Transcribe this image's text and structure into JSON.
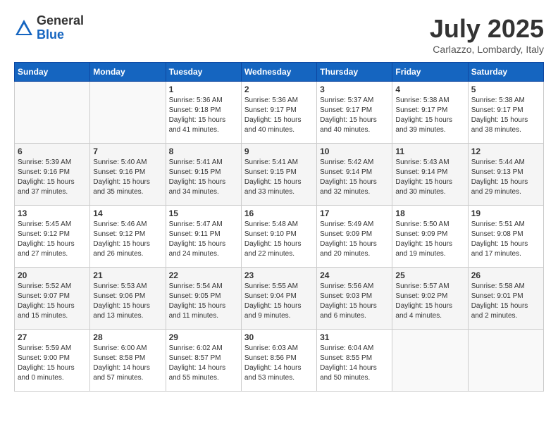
{
  "header": {
    "logo_general": "General",
    "logo_blue": "Blue",
    "month_year": "July 2025",
    "location": "Carlazzo, Lombardy, Italy"
  },
  "days_of_week": [
    "Sunday",
    "Monday",
    "Tuesday",
    "Wednesday",
    "Thursday",
    "Friday",
    "Saturday"
  ],
  "weeks": [
    [
      {
        "num": "",
        "lines": []
      },
      {
        "num": "",
        "lines": []
      },
      {
        "num": "1",
        "lines": [
          "Sunrise: 5:36 AM",
          "Sunset: 9:18 PM",
          "Daylight: 15 hours",
          "and 41 minutes."
        ]
      },
      {
        "num": "2",
        "lines": [
          "Sunrise: 5:36 AM",
          "Sunset: 9:17 PM",
          "Daylight: 15 hours",
          "and 40 minutes."
        ]
      },
      {
        "num": "3",
        "lines": [
          "Sunrise: 5:37 AM",
          "Sunset: 9:17 PM",
          "Daylight: 15 hours",
          "and 40 minutes."
        ]
      },
      {
        "num": "4",
        "lines": [
          "Sunrise: 5:38 AM",
          "Sunset: 9:17 PM",
          "Daylight: 15 hours",
          "and 39 minutes."
        ]
      },
      {
        "num": "5",
        "lines": [
          "Sunrise: 5:38 AM",
          "Sunset: 9:17 PM",
          "Daylight: 15 hours",
          "and 38 minutes."
        ]
      }
    ],
    [
      {
        "num": "6",
        "lines": [
          "Sunrise: 5:39 AM",
          "Sunset: 9:16 PM",
          "Daylight: 15 hours",
          "and 37 minutes."
        ]
      },
      {
        "num": "7",
        "lines": [
          "Sunrise: 5:40 AM",
          "Sunset: 9:16 PM",
          "Daylight: 15 hours",
          "and 35 minutes."
        ]
      },
      {
        "num": "8",
        "lines": [
          "Sunrise: 5:41 AM",
          "Sunset: 9:15 PM",
          "Daylight: 15 hours",
          "and 34 minutes."
        ]
      },
      {
        "num": "9",
        "lines": [
          "Sunrise: 5:41 AM",
          "Sunset: 9:15 PM",
          "Daylight: 15 hours",
          "and 33 minutes."
        ]
      },
      {
        "num": "10",
        "lines": [
          "Sunrise: 5:42 AM",
          "Sunset: 9:14 PM",
          "Daylight: 15 hours",
          "and 32 minutes."
        ]
      },
      {
        "num": "11",
        "lines": [
          "Sunrise: 5:43 AM",
          "Sunset: 9:14 PM",
          "Daylight: 15 hours",
          "and 30 minutes."
        ]
      },
      {
        "num": "12",
        "lines": [
          "Sunrise: 5:44 AM",
          "Sunset: 9:13 PM",
          "Daylight: 15 hours",
          "and 29 minutes."
        ]
      }
    ],
    [
      {
        "num": "13",
        "lines": [
          "Sunrise: 5:45 AM",
          "Sunset: 9:12 PM",
          "Daylight: 15 hours",
          "and 27 minutes."
        ]
      },
      {
        "num": "14",
        "lines": [
          "Sunrise: 5:46 AM",
          "Sunset: 9:12 PM",
          "Daylight: 15 hours",
          "and 26 minutes."
        ]
      },
      {
        "num": "15",
        "lines": [
          "Sunrise: 5:47 AM",
          "Sunset: 9:11 PM",
          "Daylight: 15 hours",
          "and 24 minutes."
        ]
      },
      {
        "num": "16",
        "lines": [
          "Sunrise: 5:48 AM",
          "Sunset: 9:10 PM",
          "Daylight: 15 hours",
          "and 22 minutes."
        ]
      },
      {
        "num": "17",
        "lines": [
          "Sunrise: 5:49 AM",
          "Sunset: 9:09 PM",
          "Daylight: 15 hours",
          "and 20 minutes."
        ]
      },
      {
        "num": "18",
        "lines": [
          "Sunrise: 5:50 AM",
          "Sunset: 9:09 PM",
          "Daylight: 15 hours",
          "and 19 minutes."
        ]
      },
      {
        "num": "19",
        "lines": [
          "Sunrise: 5:51 AM",
          "Sunset: 9:08 PM",
          "Daylight: 15 hours",
          "and 17 minutes."
        ]
      }
    ],
    [
      {
        "num": "20",
        "lines": [
          "Sunrise: 5:52 AM",
          "Sunset: 9:07 PM",
          "Daylight: 15 hours",
          "and 15 minutes."
        ]
      },
      {
        "num": "21",
        "lines": [
          "Sunrise: 5:53 AM",
          "Sunset: 9:06 PM",
          "Daylight: 15 hours",
          "and 13 minutes."
        ]
      },
      {
        "num": "22",
        "lines": [
          "Sunrise: 5:54 AM",
          "Sunset: 9:05 PM",
          "Daylight: 15 hours",
          "and 11 minutes."
        ]
      },
      {
        "num": "23",
        "lines": [
          "Sunrise: 5:55 AM",
          "Sunset: 9:04 PM",
          "Daylight: 15 hours",
          "and 9 minutes."
        ]
      },
      {
        "num": "24",
        "lines": [
          "Sunrise: 5:56 AM",
          "Sunset: 9:03 PM",
          "Daylight: 15 hours",
          "and 6 minutes."
        ]
      },
      {
        "num": "25",
        "lines": [
          "Sunrise: 5:57 AM",
          "Sunset: 9:02 PM",
          "Daylight: 15 hours",
          "and 4 minutes."
        ]
      },
      {
        "num": "26",
        "lines": [
          "Sunrise: 5:58 AM",
          "Sunset: 9:01 PM",
          "Daylight: 15 hours",
          "and 2 minutes."
        ]
      }
    ],
    [
      {
        "num": "27",
        "lines": [
          "Sunrise: 5:59 AM",
          "Sunset: 9:00 PM",
          "Daylight: 15 hours",
          "and 0 minutes."
        ]
      },
      {
        "num": "28",
        "lines": [
          "Sunrise: 6:00 AM",
          "Sunset: 8:58 PM",
          "Daylight: 14 hours",
          "and 57 minutes."
        ]
      },
      {
        "num": "29",
        "lines": [
          "Sunrise: 6:02 AM",
          "Sunset: 8:57 PM",
          "Daylight: 14 hours",
          "and 55 minutes."
        ]
      },
      {
        "num": "30",
        "lines": [
          "Sunrise: 6:03 AM",
          "Sunset: 8:56 PM",
          "Daylight: 14 hours",
          "and 53 minutes."
        ]
      },
      {
        "num": "31",
        "lines": [
          "Sunrise: 6:04 AM",
          "Sunset: 8:55 PM",
          "Daylight: 14 hours",
          "and 50 minutes."
        ]
      },
      {
        "num": "",
        "lines": []
      },
      {
        "num": "",
        "lines": []
      }
    ]
  ]
}
